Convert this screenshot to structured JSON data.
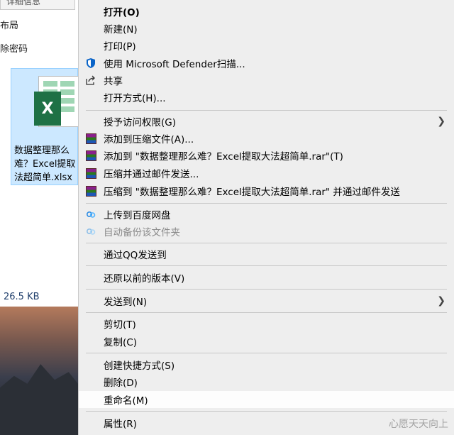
{
  "explorer": {
    "header_partial": "详细信息",
    "row_layout": "布局",
    "row_password": "除密码",
    "file_name_lines": [
      "数据整理那么",
      "难？Excel提取",
      "法超简单.xlsx"
    ],
    "excel_badge": "X",
    "file_size": "26.5 KB"
  },
  "menu": {
    "open": "打开(O)",
    "new": "新建(N)",
    "print": "打印(P)",
    "defender": "使用 Microsoft Defender扫描...",
    "share": "共享",
    "open_with": "打开方式(H)...",
    "grant_access": "授予访问权限(G)",
    "add_archive": "添加到压缩文件(A)...",
    "add_rar": "添加到 \"数据整理那么难？Excel提取大法超简单.rar\"(T)",
    "compress_email": "压缩并通过邮件发送...",
    "compress_rar_email": "压缩到 \"数据整理那么难？Excel提取大法超简单.rar\" 并通过邮件发送",
    "baidu_upload": "上传到百度网盘",
    "auto_backup": "自动备份该文件夹",
    "send_qq": "通过QQ发送到",
    "restore_versions": "还原以前的版本(V)",
    "send_to": "发送到(N)",
    "cut": "剪切(T)",
    "copy": "复制(C)",
    "create_shortcut": "创建快捷方式(S)",
    "delete": "删除(D)",
    "rename": "重命名(M)",
    "properties": "属性(R)"
  },
  "icons": {
    "defender": "shield-icon",
    "share": "share-icon",
    "winrar": "winrar-icon",
    "baidu": "baidu-netdisk-icon",
    "submenu": "chevron-right-icon"
  },
  "colors": {
    "menu_bg": "#eeeeee",
    "selection_bg": "#cce8ff",
    "excel_green": "#1e7145",
    "defender_blue": "#0a64c8"
  },
  "watermark": "心愿天天向上"
}
